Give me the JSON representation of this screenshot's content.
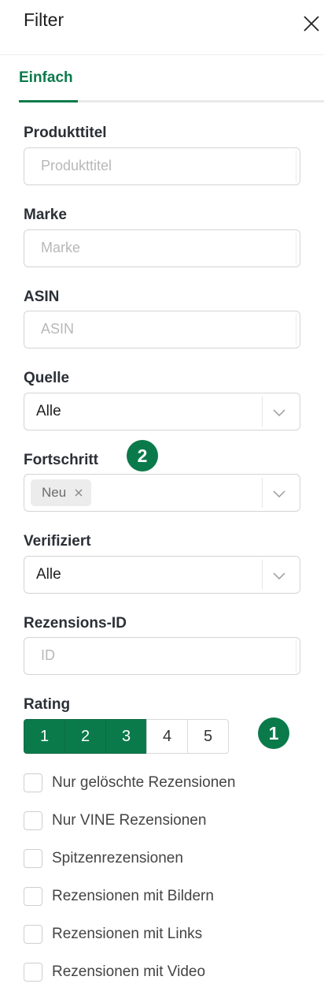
{
  "header": {
    "title": "Filter"
  },
  "tabs": [
    {
      "label": "Einfach"
    }
  ],
  "accent": "#0b7a4b",
  "fields": {
    "title": {
      "label": "Produkttitel",
      "placeholder": "Produkttitel"
    },
    "brand": {
      "label": "Marke",
      "placeholder": "Marke"
    },
    "asin": {
      "label": "ASIN",
      "placeholder": "ASIN"
    },
    "source": {
      "label": "Quelle",
      "value": "Alle"
    },
    "progress": {
      "label": "Fortschritt",
      "tag": "Neu"
    },
    "verified": {
      "label": "Verifiziert",
      "value": "Alle"
    },
    "review_id": {
      "label": "Rezensions-ID",
      "placeholder": "ID"
    }
  },
  "rating": {
    "label": "Rating",
    "options": [
      "1",
      "2",
      "3",
      "4",
      "5"
    ],
    "selected": [
      "1",
      "2",
      "3"
    ]
  },
  "badges": {
    "progress_badge": "2",
    "rating_badge": "1"
  },
  "checkboxes": [
    "Nur gelöschte Rezensionen",
    "Nur VINE Rezensionen",
    "Spitzenrezensionen",
    "Rezensionen mit Bildern",
    "Rezensionen mit Links",
    "Rezensionen mit Video"
  ],
  "icons": {
    "close": "close-icon",
    "dropdown": "chevron-down-icon",
    "tag_remove": "x-icon"
  }
}
